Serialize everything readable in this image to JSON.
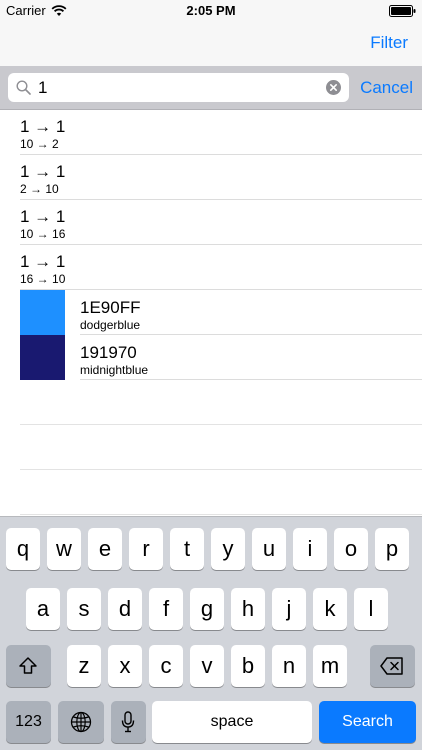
{
  "status_bar": {
    "carrier": "Carrier",
    "time": "2:05 PM"
  },
  "nav": {
    "filter_label": "Filter"
  },
  "search": {
    "value": "1",
    "cancel_label": "Cancel"
  },
  "results": [
    {
      "title": "1 → 1",
      "subtitle": "10 → 2"
    },
    {
      "title": "1 → 1",
      "subtitle": "2 → 10"
    },
    {
      "title": "1 → 1",
      "subtitle": "10 → 16"
    },
    {
      "title": "1 → 1",
      "subtitle": "16 → 10"
    }
  ],
  "colors": [
    {
      "hex": "1E90FF",
      "name": "dodgerblue",
      "swatch": "#1e90ff"
    },
    {
      "hex": "191970",
      "name": "midnightblue",
      "swatch": "#191970"
    }
  ],
  "keyboard": {
    "row1": [
      "q",
      "w",
      "e",
      "r",
      "t",
      "y",
      "u",
      "i",
      "o",
      "p"
    ],
    "row2": [
      "a",
      "s",
      "d",
      "f",
      "g",
      "h",
      "j",
      "k",
      "l"
    ],
    "row3": [
      "z",
      "x",
      "c",
      "v",
      "b",
      "n",
      "m"
    ],
    "numbers_label": "123",
    "space_label": "space",
    "search_label": "Search"
  },
  "accent_color": "#0a7aff"
}
